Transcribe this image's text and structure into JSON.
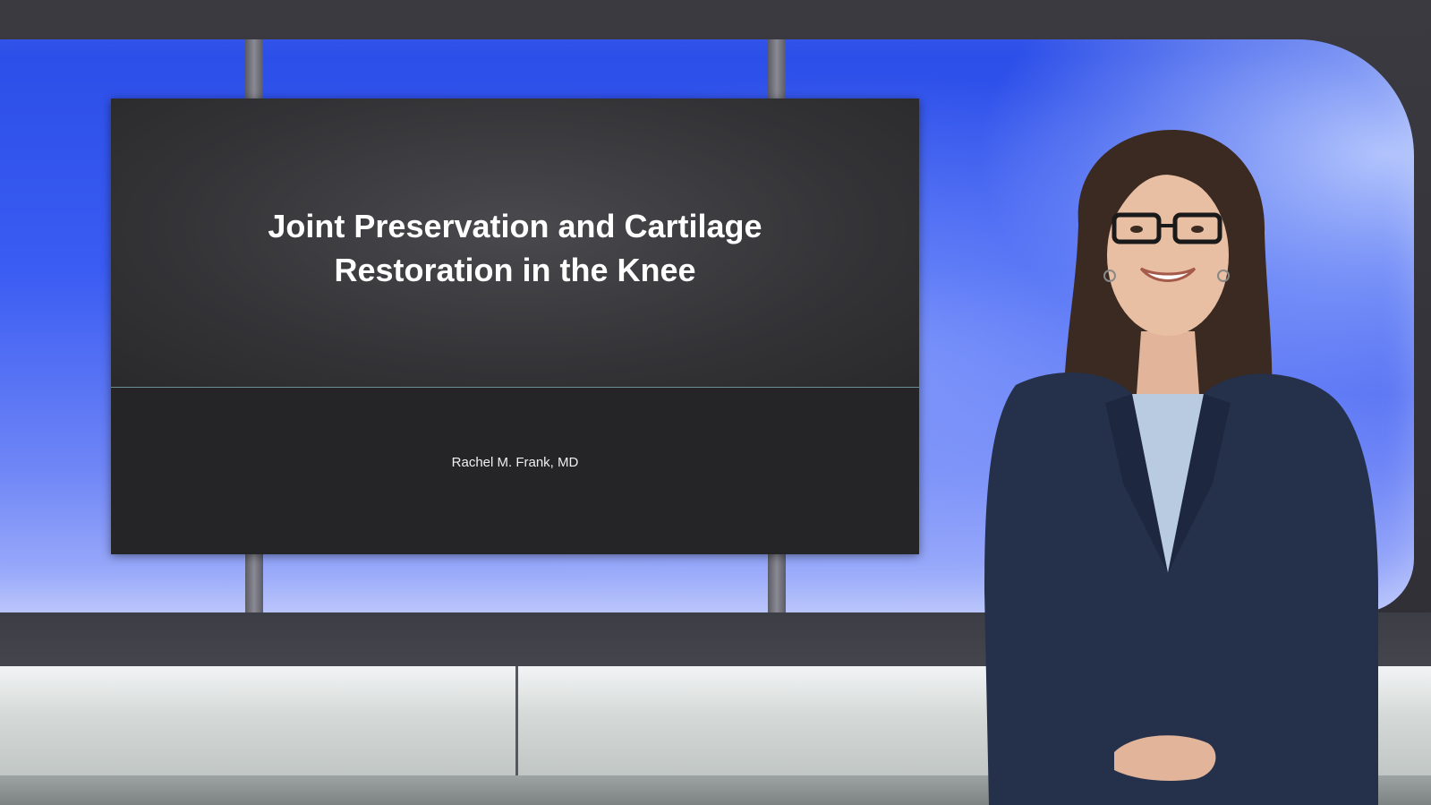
{
  "slide": {
    "title_line1": "Joint Preservation and Cartilage",
    "title_line2": "Restoration in the Knee",
    "author": "Rachel M. Frank, MD"
  },
  "presenter": {
    "icon": "person-presenter-icon"
  },
  "colors": {
    "backdrop_blue": "#3a5cf2",
    "slide_background": "#252527",
    "slide_divider": "#6a8c95",
    "floor_light": "#f2f4f5",
    "blazer_navy": "#25304a"
  }
}
